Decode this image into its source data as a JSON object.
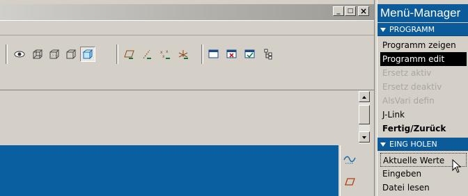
{
  "window": {
    "buttons": {
      "minimize": "_",
      "maximize": "□",
      "close": "×"
    }
  },
  "toolbar": {
    "icons": [
      "view-eye-icon",
      "wireframe-cube-icon",
      "hidden-line-cube-icon",
      "no-hidden-cube-icon",
      "shaded-cube-icon",
      "datum-plane-icon",
      "datum-axis-icon",
      "datum-point-icon",
      "coordinate-system-icon",
      "window-icon",
      "close-window-icon",
      "activate-window-icon",
      "model-tree-icon"
    ]
  },
  "side_toolbar": {
    "icons": [
      "datum-curve-icon",
      "sketch-plane-icon"
    ]
  },
  "menu_manager": {
    "title": "Menü-Manager",
    "sections": [
      {
        "header": "PROGRAMM",
        "items": [
          {
            "label": "Programm zeigen",
            "state": "normal"
          },
          {
            "label": "Programm edit",
            "state": "selected"
          },
          {
            "label": "Ersetz aktiv",
            "state": "disabled"
          },
          {
            "label": "Ersetz deaktiv",
            "state": "disabled"
          },
          {
            "label": "AlsVari defin",
            "state": "disabled"
          },
          {
            "label": "J-Link",
            "state": "normal"
          },
          {
            "label": "Fertig/Zurück",
            "state": "bold"
          }
        ]
      },
      {
        "header": "EING HOLEN",
        "items": [
          {
            "label": "Aktuelle Werte",
            "state": "hover"
          },
          {
            "label": "Eingeben",
            "state": "normal"
          },
          {
            "label": "Datei lesen",
            "state": "normal"
          }
        ]
      }
    ]
  },
  "colors": {
    "menu_header_bg": "#0b5a9a",
    "graphics_bg": "#0a5fa0",
    "selected_bg": "#000000",
    "disabled_text": "#a8a6a0",
    "chrome": "#d4d0c8"
  }
}
